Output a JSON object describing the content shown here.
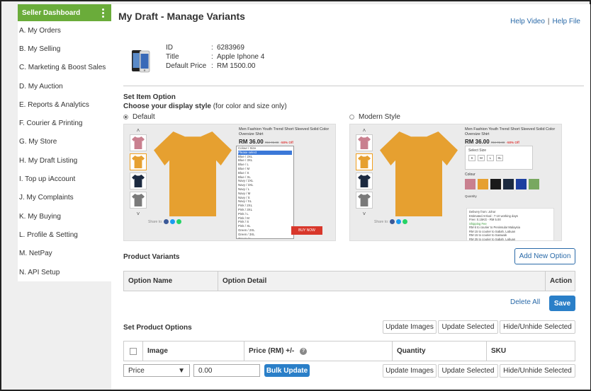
{
  "sidebar": {
    "title": "Seller Dashboard",
    "items": [
      {
        "label": "A. My Orders"
      },
      {
        "label": "B. My Selling"
      },
      {
        "label": "C. Marketing & Boost Sales"
      },
      {
        "label": "D. My Auction"
      },
      {
        "label": "E. Reports & Analytics"
      },
      {
        "label": "F. Courier & Printing"
      },
      {
        "label": "G. My Store"
      },
      {
        "label": "H. My Draft Listing"
      },
      {
        "label": "I. Top up iAccount"
      },
      {
        "label": "J. My Complaints"
      },
      {
        "label": "K. My Buying"
      },
      {
        "label": "L. Profile & Setting"
      },
      {
        "label": "M. NetPay"
      },
      {
        "label": "N. API Setup"
      }
    ]
  },
  "header": {
    "title": "My Draft - Manage Variants",
    "help_video": "Help Video",
    "separator": "|",
    "help_file": "Help File"
  },
  "item": {
    "id_label": "ID",
    "id": "6283969",
    "title_label": "Title",
    "title": "Apple Iphone 4",
    "price_label": "Default Price",
    "price": "RM 1500.00",
    "colon": ":"
  },
  "item_option": {
    "title": "Set Item Option",
    "subtitle_bold": "Choose your display style",
    "subtitle_rest": "(for color and size only)",
    "default_label": "Default",
    "modern_label": "Modern Style",
    "selected": "Default"
  },
  "preview": {
    "product_title": "Men Fashion Youth Trend Short Sleeved Solid Color Oversize Shirt",
    "price": "RM 36.00",
    "old_price": "RM 72.00",
    "discount": "-50% Off",
    "share_label": "Share to:",
    "buy_now": "BUY NOW",
    "dropdown_label": "Colour / Size",
    "dropdown_options": [
      "Please select",
      "Blue / 2XL",
      "Blue / 3XL",
      "Blue / L",
      "Blue / M",
      "Blue / S",
      "Blue / XL",
      "Navy / 2XL",
      "Navy / 3XL",
      "Navy / L",
      "Navy / M",
      "Navy / S",
      "Navy / XL",
      "Pink / 2XL",
      "Pink / 3XL",
      "Pink / L",
      "Pink / M",
      "Pink / S",
      "Pink / XL",
      "Green / 2XL",
      "Green / 3XL",
      "Green / L"
    ],
    "select_size": "Select Size",
    "sizes": [
      "S",
      "M",
      "L",
      "XL"
    ],
    "color_label": "Colour",
    "quantity": "Quantity",
    "info_lines": [
      "Delivery from: Johor",
      "Estimated Arrival : 7-10 working days",
      "Free: 0.15KG - RM 5.00",
      "Shipping Fee",
      "RM 6 to courier to Peninsular Malaysia",
      "RM 15 to courier to Sabah, Labuan",
      "RM 15 to courier to Sarawak",
      "RM 25 to courier to Sabah, Labuan"
    ],
    "colors": {
      "tee": "#e6a030",
      "pink": "#c9808f",
      "navy": "#1c2a40",
      "gray": "#7a7a7a",
      "blue": "#1d3fa0",
      "green": "#78a860",
      "black": "#1a1a1a"
    }
  },
  "variants": {
    "title": "Product Variants",
    "add_button": "Add New Option",
    "columns": [
      "Option Name",
      "Option Detail",
      "Action"
    ],
    "delete_all": "Delete All",
    "save": "Save"
  },
  "product_options": {
    "title": "Set Product Options",
    "update_images": "Update Images",
    "update_selected": "Update Selected",
    "hide_unhide": "Hide/Unhide Selected",
    "columns": [
      "Image",
      "Price (RM) +/-",
      "Quantity",
      "SKU"
    ],
    "price_help_icon": "question-icon",
    "field_select": "Price",
    "field_value": "0.00",
    "bulk_update": "Bulk Update"
  },
  "accent": {
    "green": "#6aac3a",
    "blue": "#2a7fc8",
    "link": "#2a6aa8"
  }
}
